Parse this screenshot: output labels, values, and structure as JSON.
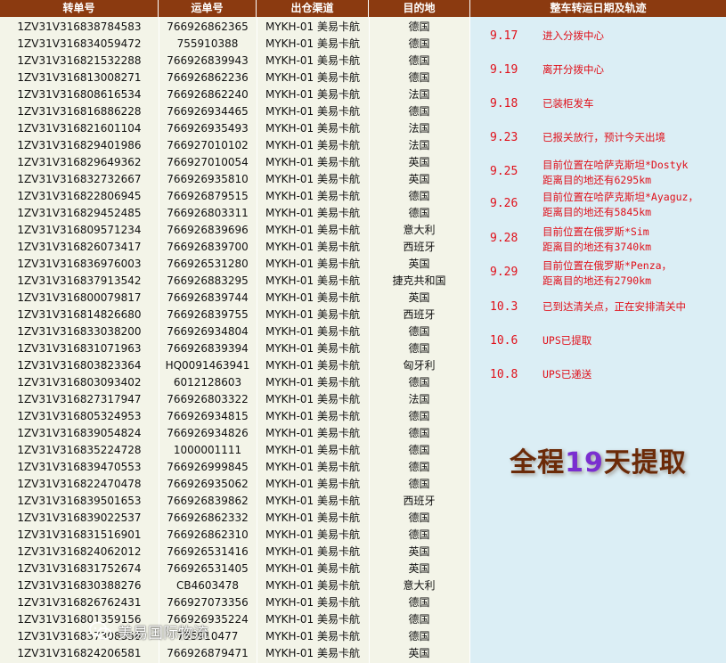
{
  "headers": [
    "转单号",
    "运单号",
    "出仓渠道",
    "目的地"
  ],
  "rows": [
    [
      "1ZV31V316838784583",
      "766926862365",
      "MYKH-01 美易卡航",
      "德国"
    ],
    [
      "1ZV31V316834059472",
      "755910388",
      "MYKH-01 美易卡航",
      "德国"
    ],
    [
      "1ZV31V316821532288",
      "766926839943",
      "MYKH-01 美易卡航",
      "德国"
    ],
    [
      "1ZV31V316813008271",
      "766926862236",
      "MYKH-01 美易卡航",
      "德国"
    ],
    [
      "1ZV31V316808616534",
      "766926862240",
      "MYKH-01 美易卡航",
      "法国"
    ],
    [
      "1ZV31V316816886228",
      "766926934465",
      "MYKH-01 美易卡航",
      "德国"
    ],
    [
      "1ZV31V316821601104",
      "766926935493",
      "MYKH-01 美易卡航",
      "法国"
    ],
    [
      "1ZV31V316829401986",
      "766927010102",
      "MYKH-01 美易卡航",
      "法国"
    ],
    [
      "1ZV31V316829649362",
      "766927010054",
      "MYKH-01 美易卡航",
      "英国"
    ],
    [
      "1ZV31V316832732667",
      "766926935810",
      "MYKH-01 美易卡航",
      "英国"
    ],
    [
      "1ZV31V316822806945",
      "766926879515",
      "MYKH-01 美易卡航",
      "德国"
    ],
    [
      "1ZV31V316829452485",
      "766926803311",
      "MYKH-01 美易卡航",
      "德国"
    ],
    [
      "1ZV31V316809571234",
      "766926839696",
      "MYKH-01 美易卡航",
      "意大利"
    ],
    [
      "1ZV31V316826073417",
      "766926839700",
      "MYKH-01 美易卡航",
      "西班牙"
    ],
    [
      "1ZV31V316836976003",
      "766926531280",
      "MYKH-01 美易卡航",
      "英国"
    ],
    [
      "1ZV31V316837913542",
      "766926883295",
      "MYKH-01 美易卡航",
      "捷克共和国"
    ],
    [
      "1ZV31V316800079817",
      "766926839744",
      "MYKH-01 美易卡航",
      "英国"
    ],
    [
      "1ZV31V316814826680",
      "766926839755",
      "MYKH-01 美易卡航",
      "西班牙"
    ],
    [
      "1ZV31V316833038200",
      "766926934804",
      "MYKH-01 美易卡航",
      "德国"
    ],
    [
      "1ZV31V316831071963",
      "766926839394",
      "MYKH-01 美易卡航",
      "德国"
    ],
    [
      "1ZV31V316803823364",
      "HQ0091463941",
      "MYKH-01 美易卡航",
      "匈牙利"
    ],
    [
      "1ZV31V316803093402",
      "6012128603",
      "MYKH-01 美易卡航",
      "德国"
    ],
    [
      "1ZV31V316827317947",
      "766926803322",
      "MYKH-01 美易卡航",
      "法国"
    ],
    [
      "1ZV31V316805324953",
      "766926934815",
      "MYKH-01 美易卡航",
      "德国"
    ],
    [
      "1ZV31V316839054824",
      "766926934826",
      "MYKH-01 美易卡航",
      "德国"
    ],
    [
      "1ZV31V316835224728",
      "1000001111",
      "MYKH-01 美易卡航",
      "德国"
    ],
    [
      "1ZV31V316839470553",
      "766926999845",
      "MYKH-01 美易卡航",
      "德国"
    ],
    [
      "1ZV31V316822470478",
      "766926935062",
      "MYKH-01 美易卡航",
      "德国"
    ],
    [
      "1ZV31V316839501653",
      "766926839862",
      "MYKH-01 美易卡航",
      "西班牙"
    ],
    [
      "1ZV31V316839022537",
      "766926862332",
      "MYKH-01 美易卡航",
      "德国"
    ],
    [
      "1ZV31V316831516901",
      "766926862310",
      "MYKH-01 美易卡航",
      "德国"
    ],
    [
      "1ZV31V316824062012",
      "766926531416",
      "MYKH-01 美易卡航",
      "英国"
    ],
    [
      "1ZV31V316831752674",
      "766926531405",
      "MYKH-01 美易卡航",
      "英国"
    ],
    [
      "1ZV31V316830388276",
      "CB4603478",
      "MYKH-01 美易卡航",
      "意大利"
    ],
    [
      "1ZV31V316826762431",
      "766927073356",
      "MYKH-01 美易卡航",
      "德国"
    ],
    [
      "1ZV31V316801359156",
      "766926935224",
      "MYKH-01 美易卡航",
      "德国"
    ],
    [
      "1ZV31V316837308358",
      "755910477",
      "MYKH-01 美易卡航",
      "德国"
    ],
    [
      "1ZV31V316824206581",
      "766926879471",
      "MYKH-01 美易卡航",
      "英国"
    ]
  ],
  "tracking": {
    "title": "整车转运日期及轨迹",
    "events": [
      {
        "date": "9.17",
        "text": "进入分拨中心"
      },
      {
        "date": "9.19",
        "text": "离开分拨中心"
      },
      {
        "date": "9.18",
        "text": "已装柜发车"
      },
      {
        "date": "9.23",
        "text": "已报关放行，预计今天出境"
      },
      {
        "date": "9.25",
        "text": "目前位置在哈萨克斯坦*Dostyk",
        "text2": "距离目的地还有6295km"
      },
      {
        "date": "9.26",
        "text": "目前位置在哈萨克斯坦*Ayaguz，",
        "text2": "距离目的地还有5845km"
      },
      {
        "date": "9.28",
        "text": "目前位置在俄罗斯*Sim",
        "text2": "距离目的地还有3740km"
      },
      {
        "date": "9.29",
        "text": "目前位置在俄罗斯*Penza，",
        "text2": "距离目的地还有2790km"
      },
      {
        "date": "10.3",
        "text": "已到达清关点，正在安排清关中"
      },
      {
        "date": "10.6",
        "text": "UPS已提取"
      },
      {
        "date": "10.8",
        "text": "UPS已递送"
      }
    ],
    "summary_prefix": "全程",
    "summary_days": "19",
    "summary_suffix": "天提取"
  },
  "watermark": "美易国际物流",
  "colors": {
    "header_bg": "#8b3a10",
    "table_bg": "#f3f4e8",
    "panel_bg": "#dbeef5",
    "event_text": "#e0101a"
  }
}
